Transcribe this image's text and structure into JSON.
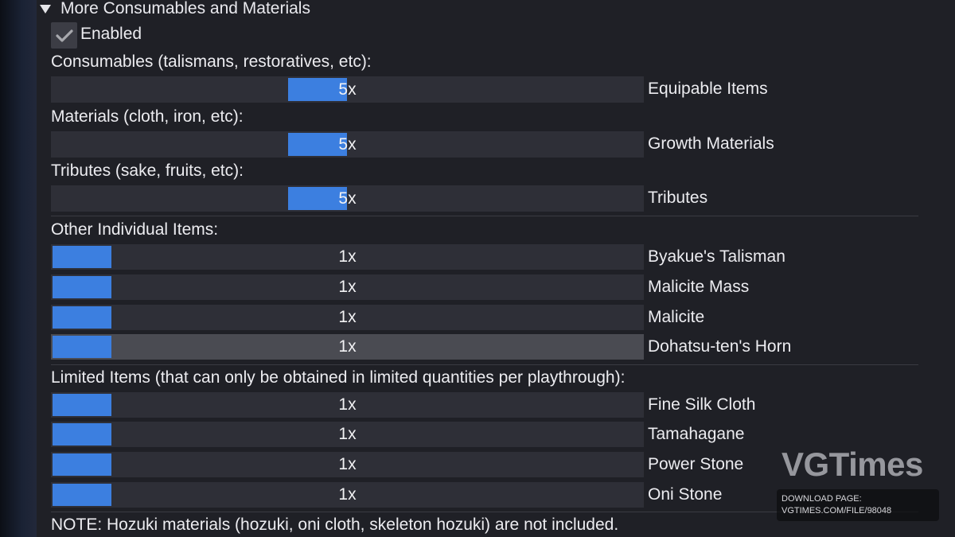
{
  "section": {
    "title": "More Consumables and Materials"
  },
  "enabled": {
    "label": "Enabled",
    "checked": true
  },
  "multipliers": [
    {
      "label": "Consumables (talismans, restoratives, etc):",
      "value": "5x",
      "side_label": "Equipable Items",
      "fill_fraction": 0.5
    },
    {
      "label": "Materials (cloth, iron, etc):",
      "value": "5x",
      "side_label": "Growth Materials",
      "fill_fraction": 0.5
    },
    {
      "label": "Tributes (sake, fruits, etc):",
      "value": "5x",
      "side_label": "Tributes",
      "fill_fraction": 0.5
    }
  ],
  "other_individual": {
    "heading": "Other Individual Items:",
    "items": [
      {
        "value": "1x",
        "side_label": "Byakue's Talisman",
        "fill_fraction": 0.0
      },
      {
        "value": "1x",
        "side_label": "Malicite Mass",
        "fill_fraction": 0.0
      },
      {
        "value": "1x",
        "side_label": "Malicite",
        "fill_fraction": 0.0
      },
      {
        "value": "1x",
        "side_label": "Dohatsu-ten's Horn",
        "fill_fraction": 0.0,
        "hovered": true
      }
    ]
  },
  "limited": {
    "heading": "Limited Items (that can only be obtained in limited quantities per playthrough):",
    "items": [
      {
        "value": "1x",
        "side_label": "Fine Silk Cloth",
        "fill_fraction": 0.0
      },
      {
        "value": "1x",
        "side_label": "Tamahagane",
        "fill_fraction": 0.0
      },
      {
        "value": "1x",
        "side_label": "Power Stone",
        "fill_fraction": 0.0
      },
      {
        "value": "1x",
        "side_label": "Oni Stone",
        "fill_fraction": 0.0
      }
    ]
  },
  "note": "NOTE: Hozuki materials (hozuki, oni cloth, skeleton hozuki) are not included.",
  "watermark": {
    "brand": "VGTimes",
    "download_line1": "DOWNLOAD PAGE:",
    "download_line2": "VGTIMES.COM/FILE/98048"
  },
  "colors": {
    "accent": "#3c7fe0",
    "slider_bg": "#2e2f37",
    "panel_bg": "#1f2026"
  },
  "icons": {
    "collapse": "triangle-down-icon",
    "check": "checkmark-icon"
  }
}
